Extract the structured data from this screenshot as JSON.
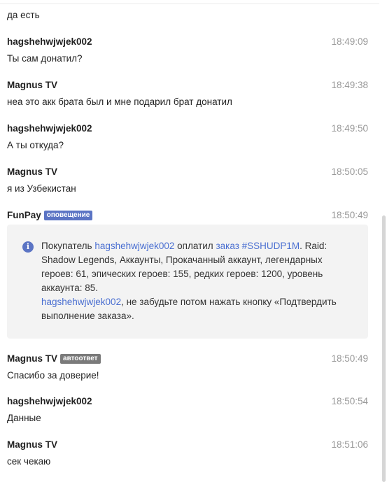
{
  "messages": [
    {
      "author": "",
      "time": "",
      "text": "да есть"
    },
    {
      "author": "hagshehwjwjek002",
      "time": "18:49:09",
      "text": "Ты сам донатил?"
    },
    {
      "author": "Magnus TV",
      "time": "18:49:38",
      "text": "неа это акк брата был и мне подарил брат донатил"
    },
    {
      "author": "hagshehwjwjek002",
      "time": "18:49:50",
      "text": "А ты откуда?"
    },
    {
      "author": "Magnus TV",
      "time": "18:50:05",
      "text": "я из Узбекистан"
    },
    {
      "author": "Magnus TV",
      "badge": "автоответ",
      "time": "18:50:49",
      "text": "Спасибо за доверие!"
    },
    {
      "author": "hagshehwjwjek002",
      "time": "18:50:54",
      "text": "Данные"
    },
    {
      "author": "Magnus TV",
      "time": "18:51:06",
      "text": "сек чекаю"
    }
  ],
  "system": {
    "author": "FunPay",
    "badge": "оповещение",
    "time": "18:50:49",
    "icon": "info-circle-icon",
    "p1_prefix": "Покупатель",
    "buyer": "hagshehwjwjek002",
    "p1_mid": "оплатил",
    "order_link": "заказ #SSHUDP1M",
    "p1_rest": ". Raid: Shadow Legends, Аккаунты, Прокачанный аккаунт, легендарных героев: 61, эпических героев: 155, редких героев: 1200, уровень аккаунта: 85.",
    "buyer2": "hagshehwjwjek002",
    "p2_rest": ", не забудьте потом нажать кнопку «Подтвердить выполнение заказа».",
    "colors": {
      "link": "#4a6fd1",
      "badge_blue": "#5b74c4",
      "badge_gray": "#7a7a7a",
      "alert_bg": "#f3f3f3"
    }
  }
}
